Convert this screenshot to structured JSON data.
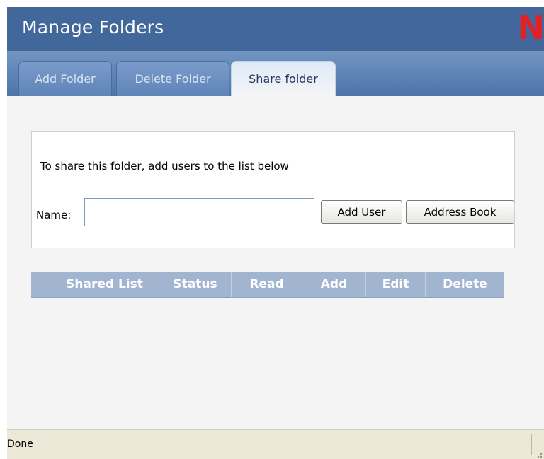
{
  "header": {
    "title": "Manage Folders",
    "logo_text": "N",
    "logo_color": "#e41f26",
    "background_color": "#41679b"
  },
  "tabs": [
    {
      "label": "Add Folder",
      "active": false
    },
    {
      "label": "Delete Folder",
      "active": false
    },
    {
      "label": "Share folder",
      "active": true
    }
  ],
  "share": {
    "instructions": "To share this folder, add users to the list below",
    "name_label": "Name:",
    "name_value": "",
    "name_placeholder": "",
    "add_user_label": "Add User",
    "address_book_label": "Address Book"
  },
  "shared_table": {
    "columns": [
      "",
      "Shared List",
      "Status",
      "Read",
      "Add",
      "Edit",
      "Delete"
    ],
    "rows": []
  },
  "statusbar": {
    "text": "Done"
  }
}
